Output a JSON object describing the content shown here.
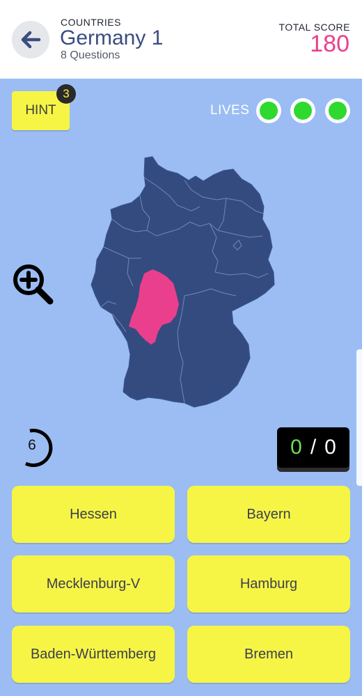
{
  "header": {
    "category": "COUNTRIES",
    "title": "Germany 1",
    "subtitle": "8 Questions",
    "score_label": "TOTAL SCORE",
    "score_value": "180"
  },
  "hint": {
    "label": "HINT",
    "count": "3"
  },
  "lives": {
    "label": "LIVES",
    "remaining": 3,
    "color": "#2fd92f"
  },
  "map": {
    "country_color": "#344b80",
    "highlight_color": "#ea3f8c",
    "highlighted_region": "Hessen"
  },
  "timer": {
    "value": "6"
  },
  "counter": {
    "correct": "0",
    "separator": "/",
    "total": "0"
  },
  "answers": [
    {
      "label": "Hessen"
    },
    {
      "label": "Bayern"
    },
    {
      "label": "Mecklenburg-V"
    },
    {
      "label": "Hamburg"
    },
    {
      "label": "Baden-Württemberg"
    },
    {
      "label": "Bremen"
    }
  ],
  "colors": {
    "background": "#9bbdf3",
    "button": "#f6f545",
    "title": "#3a4d80",
    "score": "#ea3f8c"
  }
}
